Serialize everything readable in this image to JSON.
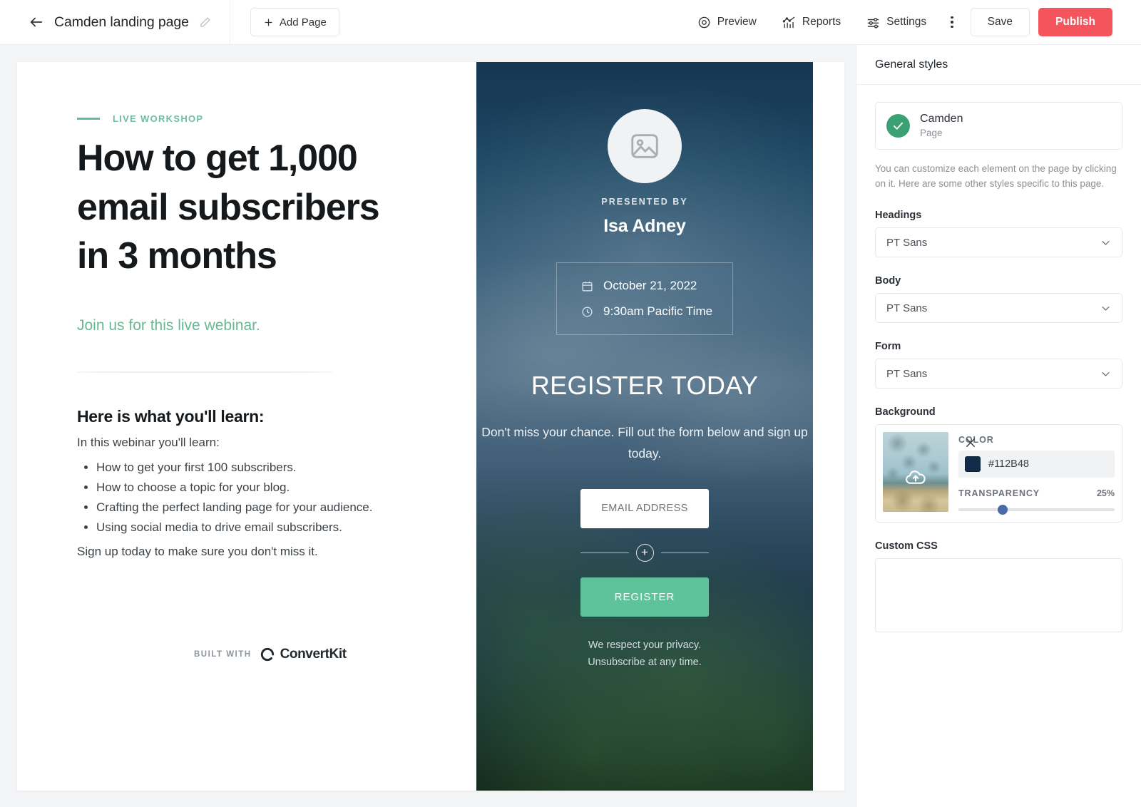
{
  "topbar": {
    "back_icon": "arrow-left-icon",
    "page_title": "Camden landing page",
    "edit_icon": "pencil-icon",
    "add_page_label": "Add Page",
    "actions": [
      {
        "label": "Preview",
        "icon": "eye-icon"
      },
      {
        "label": "Reports",
        "icon": "chart-icon"
      },
      {
        "label": "Settings",
        "icon": "sliders-icon"
      }
    ],
    "more_icon": "kebab-menu-icon",
    "save_label": "Save",
    "publish_label": "Publish",
    "publish_color": "#F4555C"
  },
  "page": {
    "eyebrow": "LIVE WORKSHOP",
    "eyebrow_color": "#6DBF9F",
    "headline": "How to get 1,000 email subscribers in 3 months",
    "subhead": "Join us for this live webinar.",
    "subhead_color": "#69B795",
    "learn_title": "Here is what you'll learn:",
    "learn_intro": "In this webinar you'll learn:",
    "learn_items": [
      "How to get your first 100 subscribers.",
      "How to choose a topic for your blog.",
      "Crafting the perfect landing page for your audience.",
      "Using social media to drive email subscribers."
    ],
    "learn_outro": "Sign up today to make sure you don't miss it.",
    "built_with_label": "BUILT WITH",
    "brand_name": "ConvertKit",
    "brand_icon": "convertkit-logo-icon"
  },
  "preview": {
    "avatar_icon": "image-placeholder-icon",
    "presented_by_label": "PRESENTED BY",
    "presenter_name": "Isa Adney",
    "event_date": "October 21, 2022",
    "event_date_icon": "calendar-icon",
    "event_time": "9:30am Pacific Time",
    "event_time_icon": "clock-icon",
    "register_title": "REGISTER TODAY",
    "pitch": "Don't miss your chance. Fill out the form below and sign up today.",
    "email_placeholder": "EMAIL ADDRESS",
    "email_value": "",
    "add_field_icon": "plus-circle-icon",
    "register_button_label": "REGISTER",
    "register_button_color": "#5EC29A",
    "privacy_line1": "We respect your privacy.",
    "privacy_line2": "Unsubscribe at any time."
  },
  "sidebar": {
    "header_title": "General styles",
    "selected": {
      "name": "Camden",
      "type": "Page",
      "status_icon": "check-circle-icon",
      "status_color": "#3AA175"
    },
    "help_text": "You can customize each element on the page by clicking on it. Here are some other styles specific to this page.",
    "fields": [
      {
        "label": "Headings",
        "value": "PT Sans"
      },
      {
        "label": "Body",
        "value": "PT Sans"
      },
      {
        "label": "Form",
        "value": "PT Sans"
      }
    ],
    "background": {
      "label": "Background",
      "upload_icon": "cloud-upload-icon",
      "remove_icon": "close-icon",
      "color_label": "COLOR",
      "color_hex": "#112B48",
      "transparency_label": "TRANSPARENCY",
      "transparency_value": "25%",
      "transparency_percent": 25
    },
    "custom_css": {
      "label": "Custom CSS",
      "value": "",
      "placeholder": ""
    }
  }
}
